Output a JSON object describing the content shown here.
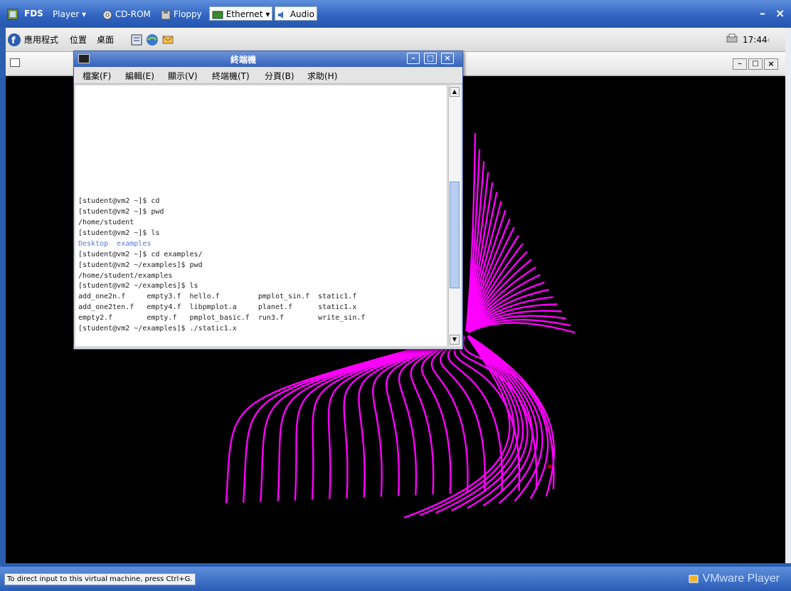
{
  "vmbar": {
    "app_name": "FDS",
    "player_menu": "Player",
    "cdrom": "CD-ROM",
    "floppy": "Floppy",
    "ethernet": "Ethernet",
    "audio": "Audio",
    "min_glyph": "–",
    "close_glyph": "×"
  },
  "panel": {
    "applications": "應用程式",
    "places": "位置",
    "desktop": "桌面",
    "time": "17:44"
  },
  "terminal": {
    "title": "終端機",
    "menu": [
      "檔案(F)",
      "編輯(E)",
      "顯示(V)",
      "終端機(T)",
      "分頁(B)",
      "求助(H)"
    ],
    "lines": [
      {
        "text": "[student@vm2 ~]$ cd",
        "color": "#222222"
      },
      {
        "text": "[student@vm2 ~]$ pwd",
        "color": "#222222"
      },
      {
        "text": "/home/student",
        "color": "#222222"
      },
      {
        "text": "[student@vm2 ~]$ ls",
        "color": "#222222"
      },
      {
        "text": "Desktop  examples",
        "color": "#5577cc"
      },
      {
        "text": "[student@vm2 ~]$ cd examples/",
        "color": "#222222"
      },
      {
        "text": "[student@vm2 ~/examples]$ pwd",
        "color": "#222222"
      },
      {
        "text": "/home/student/examples",
        "color": "#222222"
      },
      {
        "text": "[student@vm2 ~/examples]$ ls",
        "color": "#222222"
      },
      {
        "text": "add_one2n.f     empty3.f  hello.f         pmplot_sin.f  static1.f",
        "color": "#222222"
      },
      {
        "text": "add_one2ten.f   empty4.f  libpmplot.a     planet.f      static1.x",
        "color": "#222222"
      },
      {
        "text": "empty2.f        empty.f   pmplot_basic.f  run3.f        write_sin.f",
        "color": "#222222"
      },
      {
        "text": "[student@vm2 ~/examples]$ ./static1.x",
        "color": "#222222"
      }
    ]
  },
  "status": {
    "text": "To direct input to this virtual machine, press Ctrl+G.",
    "logo": "VMware Player"
  },
  "colors": {
    "plot_line": "#ff00ff",
    "terminal_title": "#3562bc",
    "vmware_bar": "#2f63c0"
  }
}
